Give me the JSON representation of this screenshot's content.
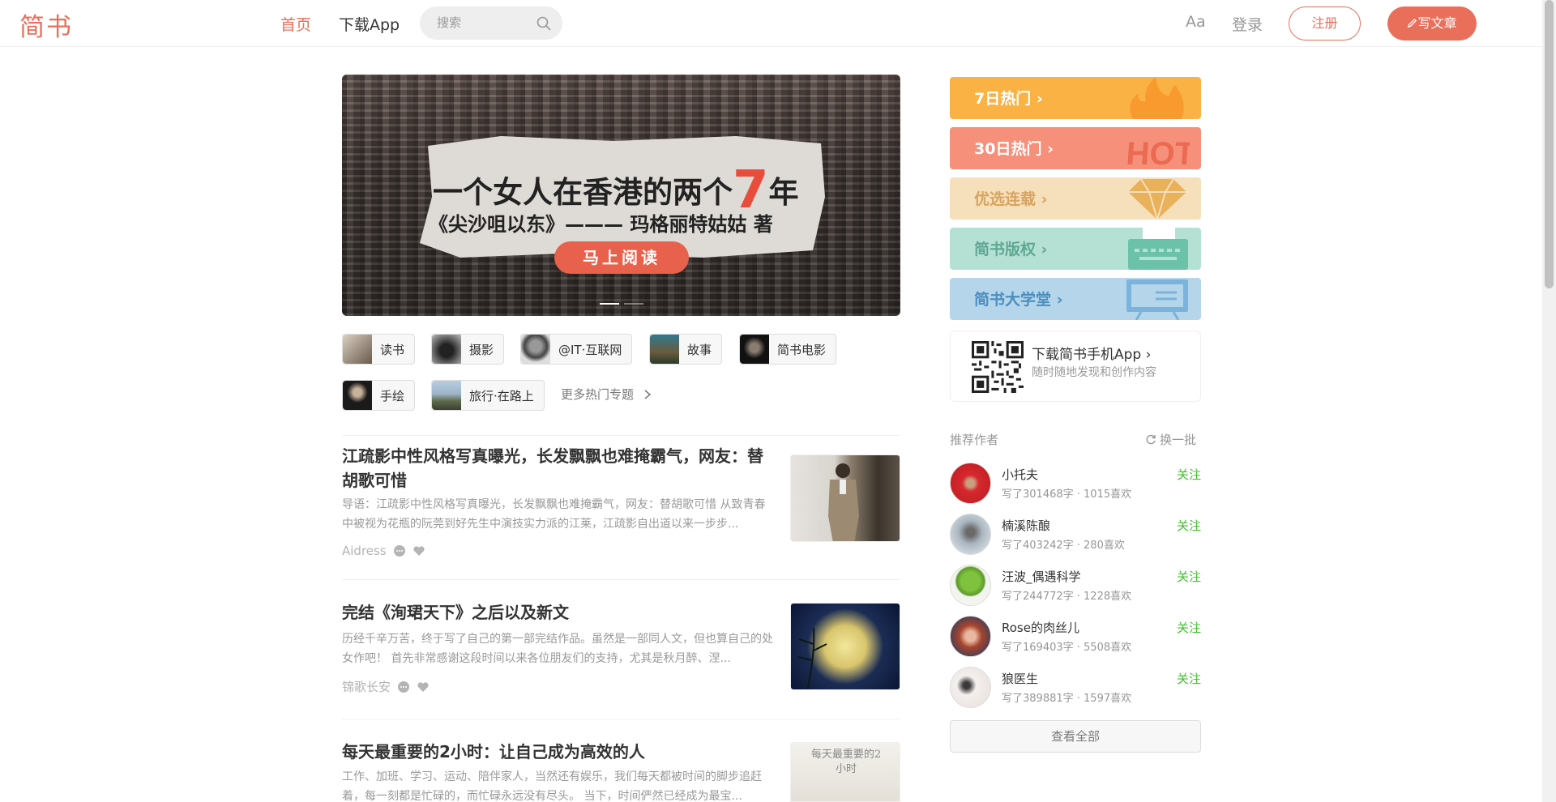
{
  "header": {
    "logo": "简书",
    "nav_home": "首页",
    "nav_app": "下载App",
    "search_placeholder": "搜索",
    "font_toggle": "Aa",
    "login": "登录",
    "register": "注册",
    "write": "写文章",
    "accent_color": "#ea6f5a"
  },
  "banner": {
    "title_prefix": "一个女人在香港的两个",
    "title_number": "7",
    "title_suffix": "年",
    "subtitle": "《尖沙咀以东》——— 玛格丽特姑姑  著",
    "cta": "马上阅读"
  },
  "topics": [
    {
      "label": "读书"
    },
    {
      "label": "摄影"
    },
    {
      "label": "@IT·互联网"
    },
    {
      "label": "故事"
    },
    {
      "label": "简书电影"
    },
    {
      "label": "手绘"
    },
    {
      "label": "旅行·在路上"
    }
  ],
  "more_topics": "更多热门专题",
  "articles": [
    {
      "title": "江疏影中性风格写真曝光，长发飘飘也难掩霸气，网友：替胡歌可惜",
      "abstract": "导语：江疏影中性风格写真曝光，长发飘飘也难掩霸气，网友：替胡歌可惜 从致青春中被视为花瓶的阮莞到好先生中演技实力派的江莱，江疏影自出道以来一步步...",
      "author": "Aidress"
    },
    {
      "title": "完结《洵珺天下》之后以及新文",
      "abstract": "历经千辛万苦，终于写了自己的第一部完结作品。虽然是一部同人文，但也算自己的处女作吧！ 首先非常感谢这段时间以来各位朋友们的支持，尤其是秋月醉、涅...",
      "author": "锦歌长安"
    },
    {
      "title": "每天最重要的2小时：让自己成为高效的人",
      "abstract": "工作、加班、学习、运动、陪伴家人，当然还有娱乐，我们每天都被时间的脚步追赶着，每一刻都是忙碌的，而忙碌永远没有尽头。 当下，时间俨然已经成为最宝...",
      "author": "",
      "image_text": "每天最重要的2小时"
    }
  ],
  "sidebar": {
    "boards": [
      {
        "label": "7日热门",
        "color": "#fbb244",
        "text_color": "#ffffff",
        "icon": "flame-icon"
      },
      {
        "label": "30日热门",
        "color": "#f7907a",
        "text_color": "#ffffff",
        "icon": "hot-icon"
      },
      {
        "label": "优选连载",
        "color": "#f6dfbb",
        "text_color": "#d6a45f",
        "icon": "diamond-icon"
      },
      {
        "label": "简书版权",
        "color": "#b5e1d5",
        "text_color": "#5fa792",
        "icon": "typewriter-icon"
      },
      {
        "label": "简书大学堂",
        "color": "#b5d5ea",
        "text_color": "#4a8ec0",
        "icon": "blackboard-icon"
      }
    ],
    "download": {
      "title": "下载简书手机App",
      "subtitle": "随时随地发现和创作内容"
    },
    "recommend_title": "推荐作者",
    "refresh": "换一批",
    "follow_label": "关注",
    "authors": [
      {
        "name": "小托夫",
        "desc": "写了301468字 · 1015喜欢"
      },
      {
        "name": "楠溪陈酿",
        "desc": "写了403242字 · 280喜欢"
      },
      {
        "name": "汪波_偶遇科学",
        "desc": "写了244772字 · 1228喜欢"
      },
      {
        "name": "Rose的肉丝儿",
        "desc": "写了169403字 · 5508喜欢"
      },
      {
        "name": "狼医生",
        "desc": "写了389881字 · 1597喜欢"
      }
    ],
    "view_all": "查看全部"
  }
}
